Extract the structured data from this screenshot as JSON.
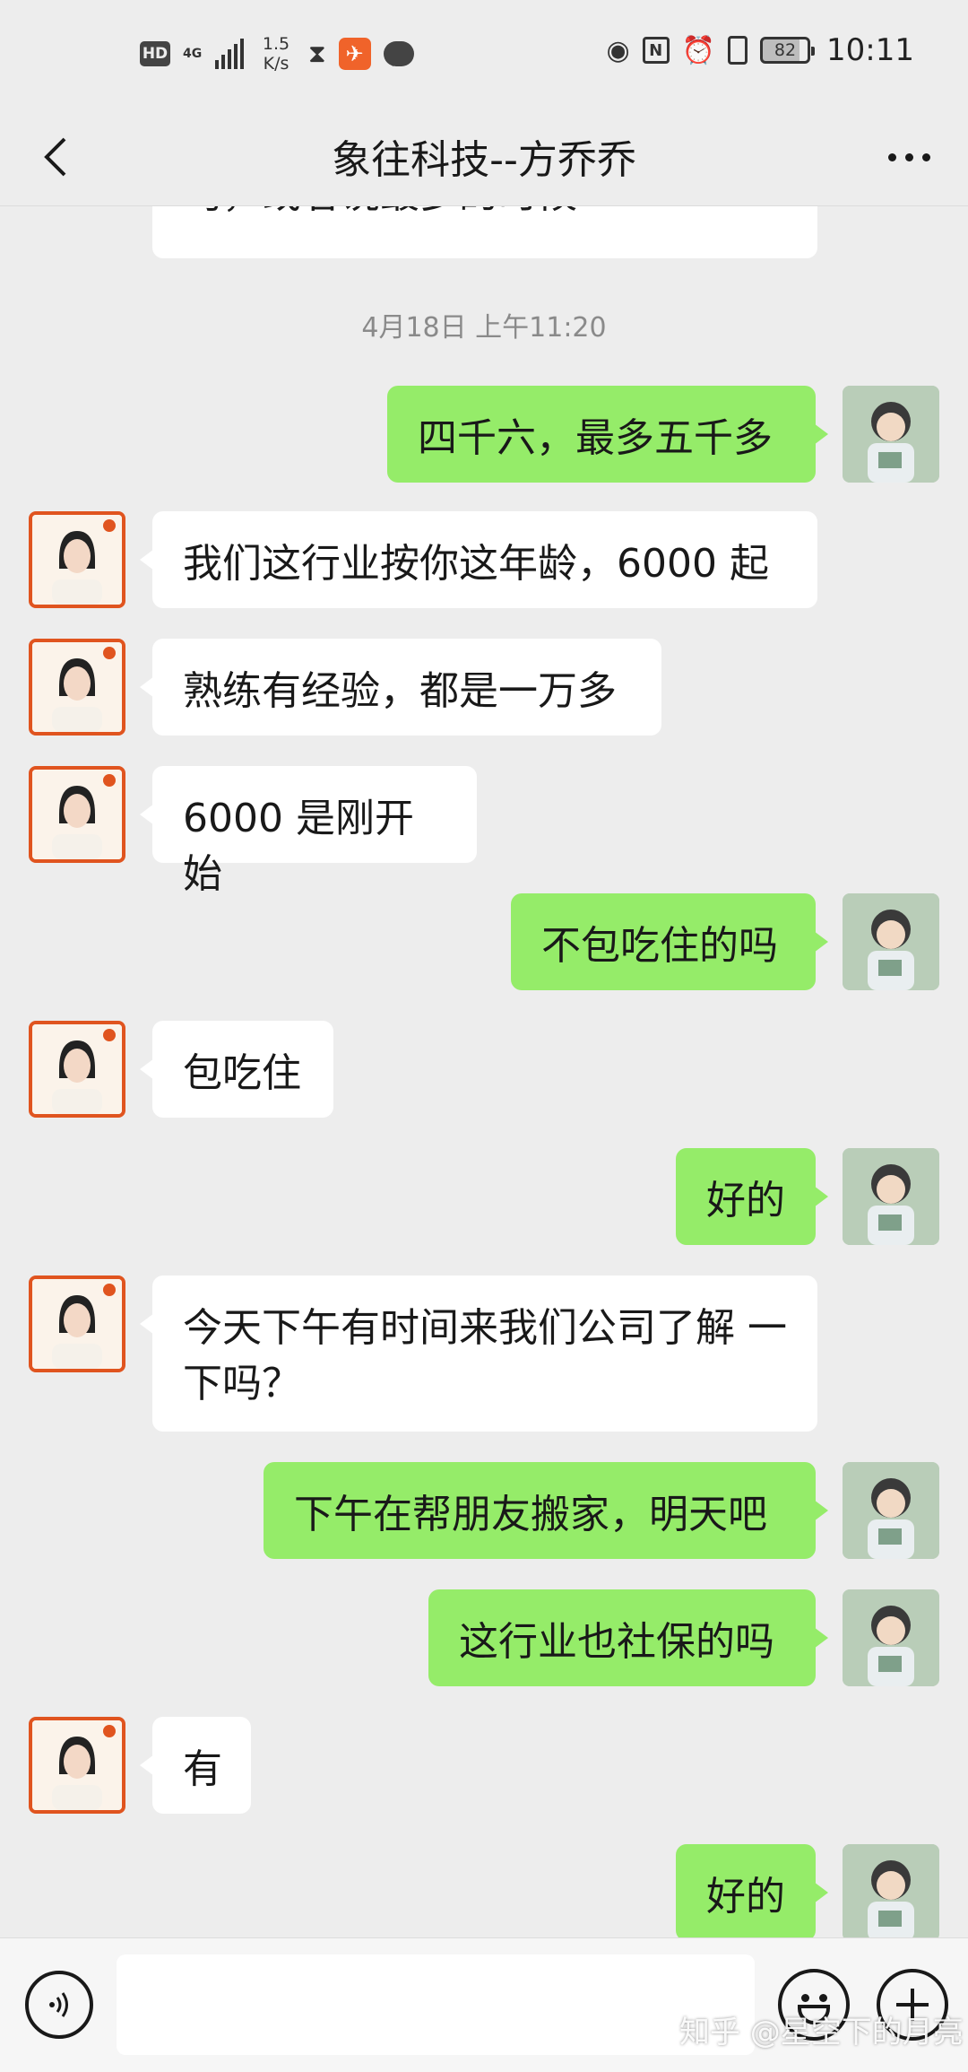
{
  "status_bar": {
    "hd": "HD",
    "network": "4G",
    "speed_value": "1.5",
    "speed_unit": "K/s",
    "battery": "82",
    "time": "10:11"
  },
  "header": {
    "title": "象往科技--方乔乔"
  },
  "timestamp": "4月18日 上午11:20",
  "messages": [
    {
      "side": "in",
      "text": "均，或者说最多的时候"
    },
    {
      "side": "out",
      "text": "四千六，最多五千多"
    },
    {
      "side": "in",
      "text": "我们这行业按你这年龄，6000 起"
    },
    {
      "side": "in",
      "text": "熟练有经验，都是一万多"
    },
    {
      "side": "in",
      "text": "6000 是刚开始"
    },
    {
      "side": "out",
      "text": "不包吃住的吗"
    },
    {
      "side": "in",
      "text": "包吃住"
    },
    {
      "side": "out",
      "text": "好的"
    },
    {
      "side": "in",
      "text": "今天下午有时间来我们公司了解 一\n下吗？"
    },
    {
      "side": "out",
      "text": "下午在帮朋友搬家，明天吧"
    },
    {
      "side": "out",
      "text": "这行业也社保的吗"
    },
    {
      "side": "in",
      "text": "有"
    },
    {
      "side": "out",
      "text": "好的"
    }
  ],
  "input_bar": {
    "placeholder": ""
  },
  "watermark": "知乎 @星空下的月亮"
}
